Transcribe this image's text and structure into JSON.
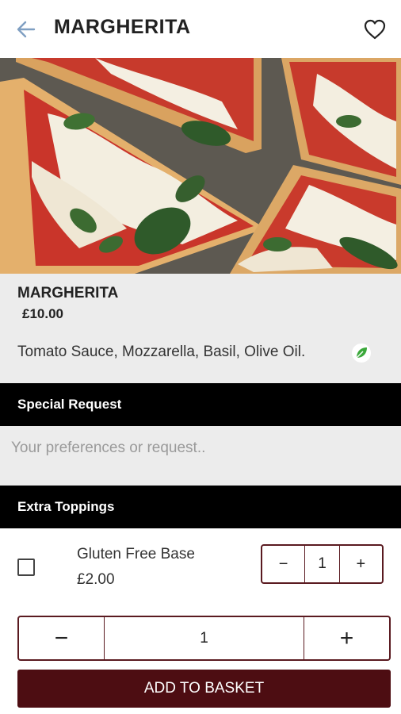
{
  "header": {
    "title": "MARGHERITA",
    "back_icon": "arrow-left-icon",
    "favorite_icon": "heart-outline-icon"
  },
  "hero": {
    "image": "margherita pizza slices"
  },
  "item": {
    "name": "MARGHERITA",
    "price": "£10.00",
    "description": "Tomato Sauce, Mozzarella, Basil, Olive Oil.",
    "diet_icon": "leaf-icon"
  },
  "special_request": {
    "heading": "Special Request",
    "placeholder": "Your preferences or request..",
    "value": ""
  },
  "extra_toppings": {
    "heading": "Extra Toppings",
    "items": [
      {
        "name": "Gluten Free Base",
        "price": "£2.00",
        "checked": false,
        "minus": "−",
        "quantity": "1",
        "plus": "+"
      }
    ]
  },
  "quantity": {
    "minus": "−",
    "value": "1",
    "plus": "+"
  },
  "add_to_basket": "ADD TO BASKET",
  "colors": {
    "accent": "#4d0d12",
    "section_bar": "#000000",
    "panel_bg": "#ececec",
    "veg_green": "#3aa83a"
  }
}
